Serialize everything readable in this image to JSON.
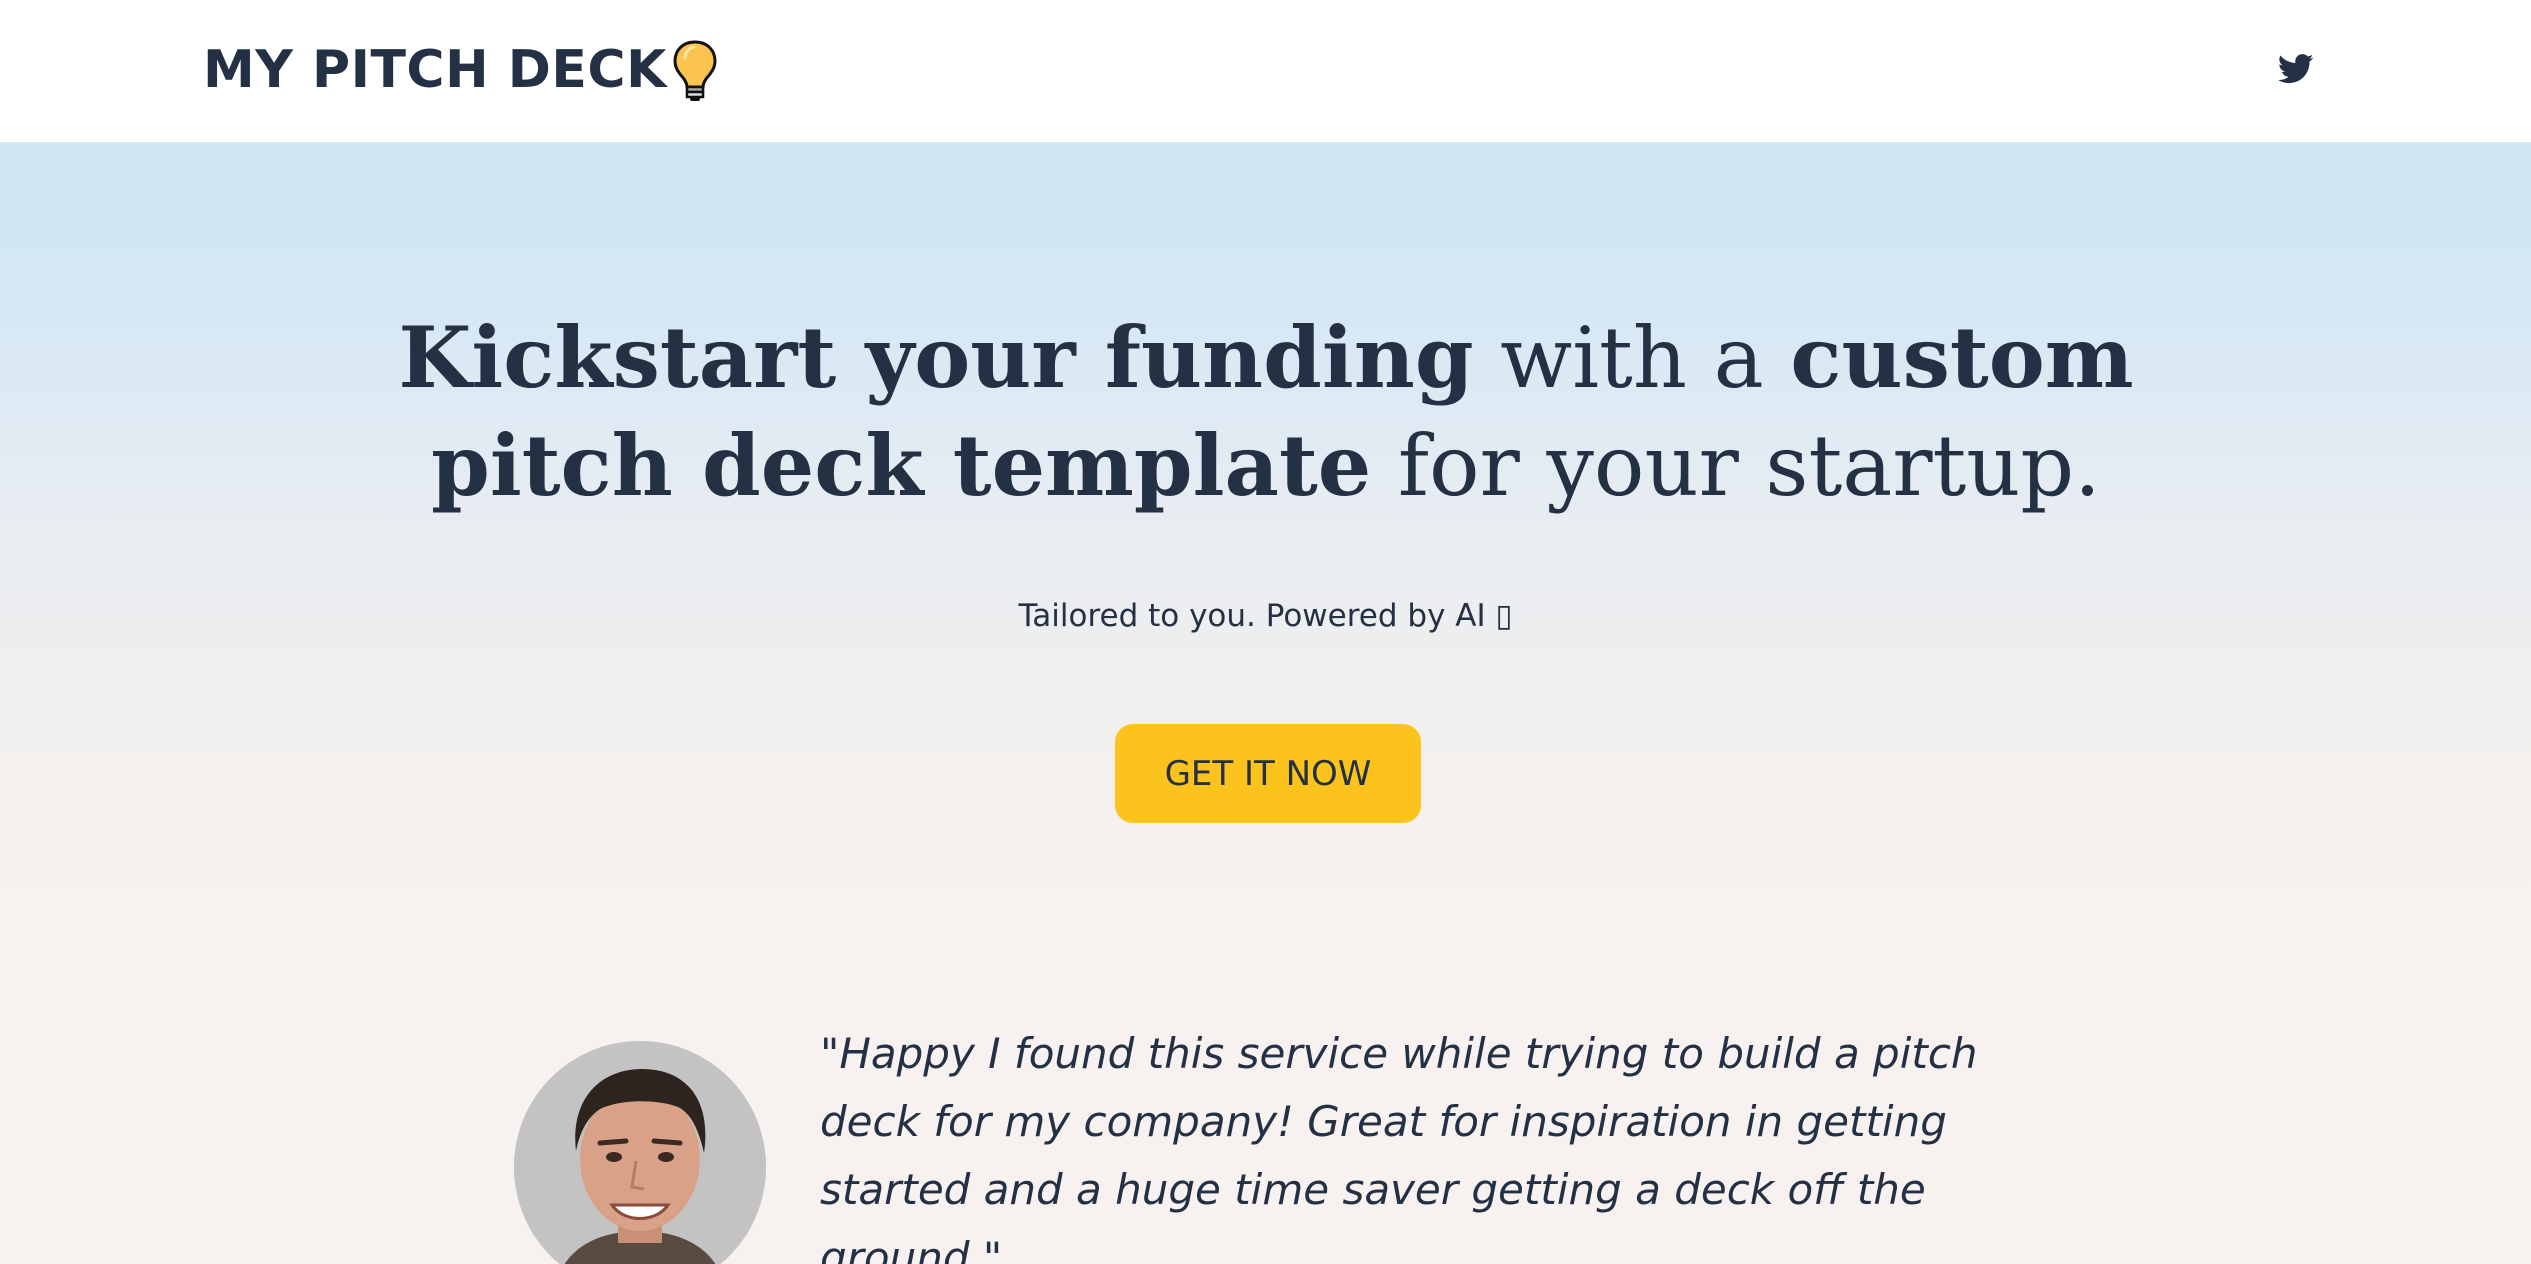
{
  "header": {
    "logo_text": "MY PITCH DECK",
    "logo_icon": "lightbulb-icon",
    "social_icon": "twitter-icon"
  },
  "hero": {
    "headline": {
      "part1_bold": "Kickstart your funding",
      "part2": " with a ",
      "part3_bold": "custom pitch deck template",
      "part4": " for your startup."
    },
    "subtitle": "Tailored to you. Powered by AI ▯",
    "cta_label": "GET IT NOW"
  },
  "testimonial": {
    "quote": "\"Happy I found this service while trying to build a pitch deck for my company! Great for inspiration in getting started and a huge time saver getting a deck off the ground.\"",
    "avatar_icon": "person-avatar"
  },
  "colors": {
    "text": "#243044",
    "accent": "#fbc31c",
    "hero_top": "#d1e7f6",
    "hero_bottom": "#f7f2ef"
  }
}
